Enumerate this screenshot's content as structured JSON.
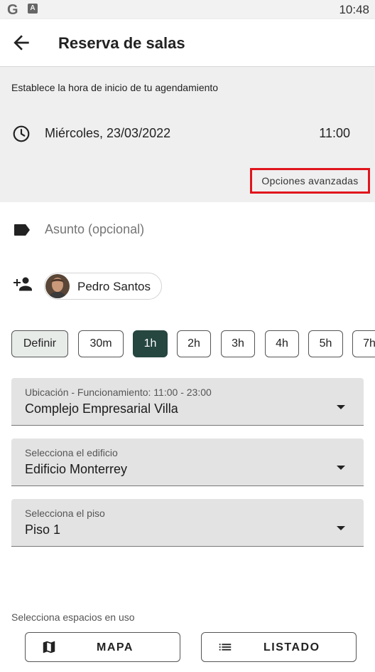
{
  "status_bar": {
    "time": "10:48",
    "g_label": "G",
    "a_label": "A"
  },
  "app_bar": {
    "title": "Reserva de salas"
  },
  "schedule": {
    "instruction": "Establece la hora de inicio de tu agendamiento",
    "date": "Miércoles, 23/03/2022",
    "time": "11:00",
    "advanced_options": "Opciones avanzadas"
  },
  "subject": {
    "placeholder": "Asunto (opcional)"
  },
  "attendee": {
    "name": "Pedro Santos"
  },
  "durations": [
    "Definir",
    "30m",
    "1h",
    "2h",
    "3h",
    "4h",
    "5h",
    "7h"
  ],
  "selected_duration": "1h",
  "location": {
    "label": "Ubicación - Funcionamiento: 11:00 - 23:00",
    "value": "Complejo Empresarial Villa"
  },
  "building": {
    "label": "Selecciona el edificio",
    "value": "Edificio Monterrey"
  },
  "floor": {
    "label": "Selecciona el piso",
    "value": "Piso 1"
  },
  "spaces": {
    "label": "Selecciona espacios en uso",
    "map_button": "MAPA",
    "list_button": "LISTADO"
  },
  "colors": {
    "accent": "#264640",
    "highlight_border": "#e0151d",
    "section_bg": "#efefef"
  }
}
